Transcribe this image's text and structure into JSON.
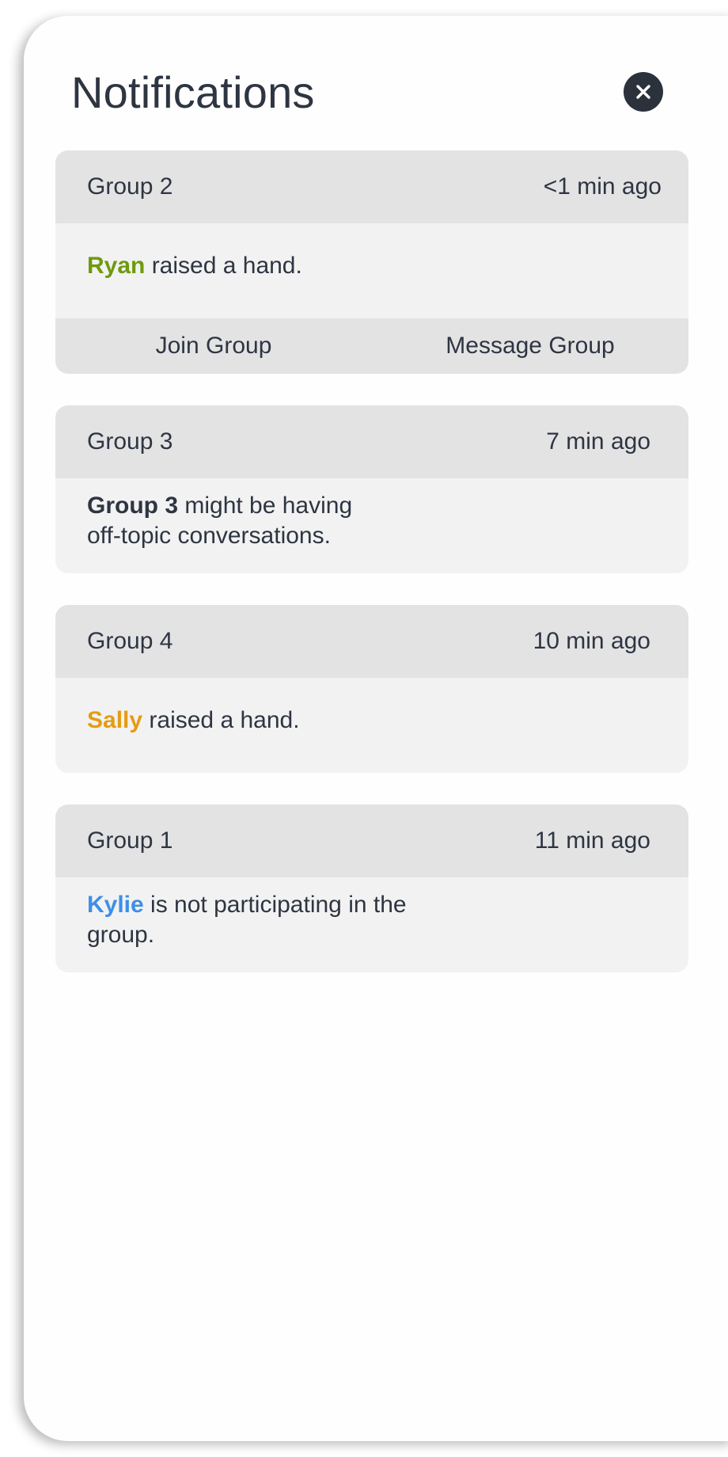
{
  "header": {
    "title": "Notifications",
    "close_icon": "close-icon"
  },
  "colors": {
    "title": "#2e3542",
    "close_button_bg": "#2c323c",
    "card_bg": "#f2f2f2",
    "card_header_bg": "#e3e3e4",
    "name_green": "#6f9a0e",
    "name_orange": "#e59c12",
    "name_blue": "#3d8fe8"
  },
  "notifications": [
    {
      "group": "Group 2",
      "time": "<1 min ago",
      "name": "Ryan",
      "message": " raised a hand.",
      "actions": {
        "join": "Join Group",
        "message": "Message Group"
      }
    },
    {
      "group": "Group 3",
      "time": "7 min ago",
      "subject": "Group 3",
      "message_line1": " might be having",
      "message_line2": "off-topic conversations."
    },
    {
      "group": "Group 4",
      "time": "10 min ago",
      "name": "Sally",
      "message": " raised a hand."
    },
    {
      "group": "Group 1",
      "time": "11 min ago",
      "name": "Kylie",
      "message_line1": " is not participating in the",
      "message_line2": "group."
    }
  ]
}
